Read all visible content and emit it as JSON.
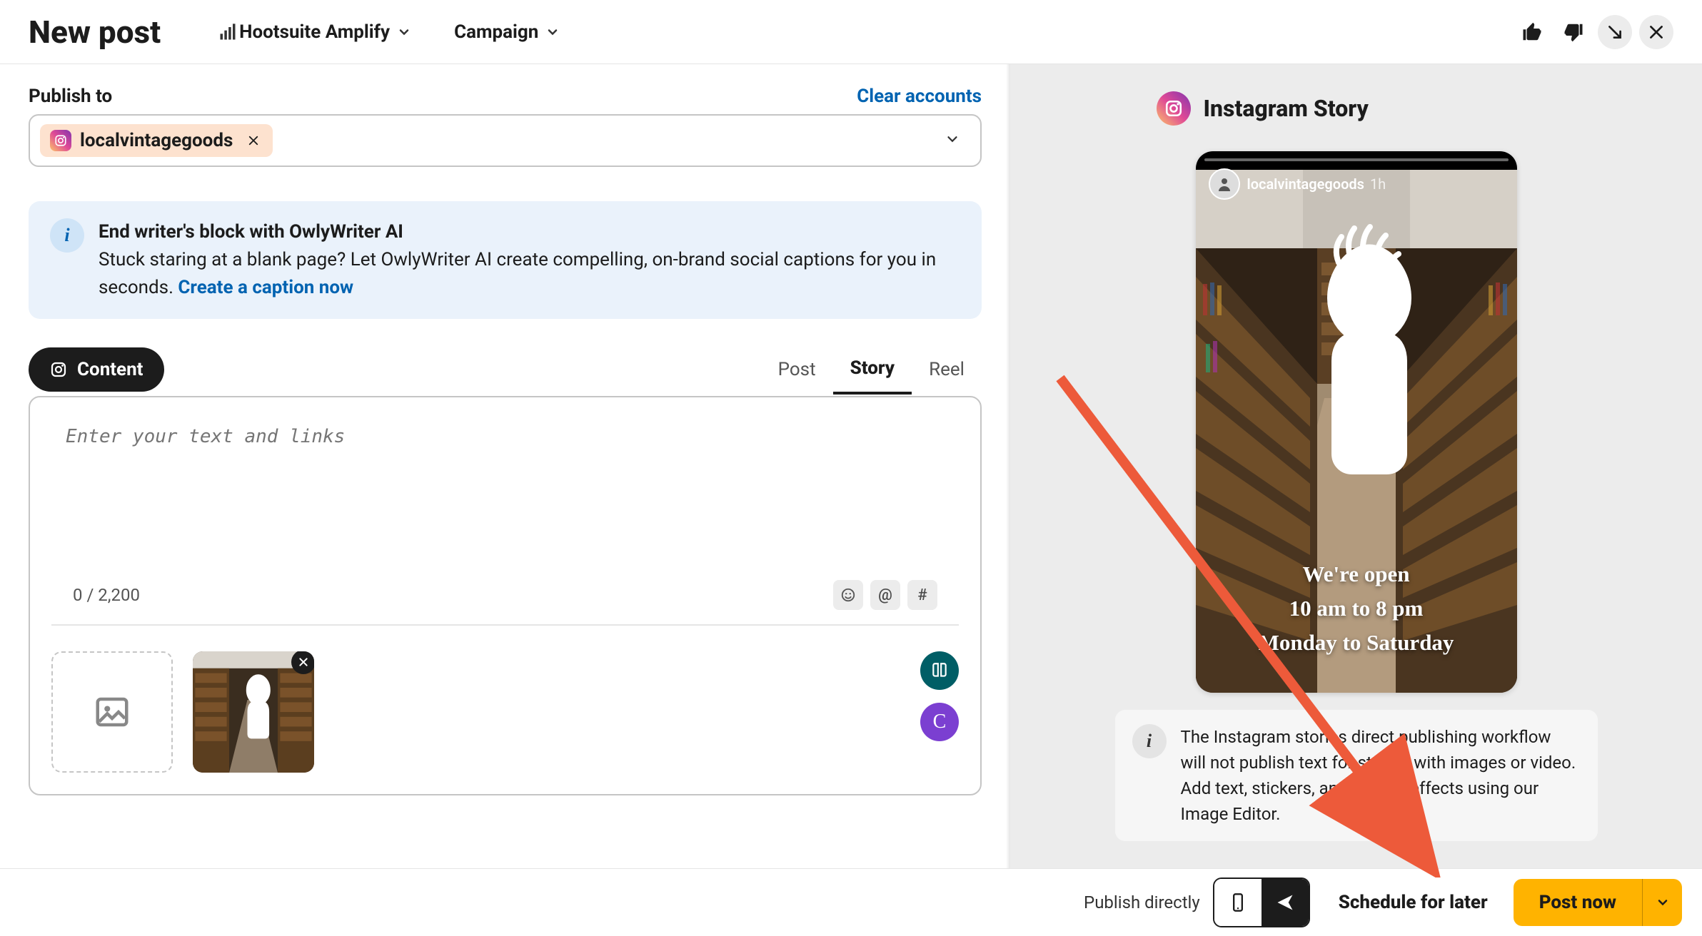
{
  "header": {
    "title": "New post",
    "amplify_label": "Hootsuite Amplify",
    "campaign_label": "Campaign"
  },
  "left": {
    "publish_label": "Publish to",
    "clear_accounts": "Clear accounts",
    "account_name": "localvintagegoods",
    "ai_title": "End writer's block with OwlyWriter AI",
    "ai_body": "Stuck staring at a blank page? Let OwlyWriter AI create compelling, on-brand social captions for you in seconds.",
    "ai_link": "Create a caption now",
    "content_tab": "Content",
    "post_types": {
      "post": "Post",
      "story": "Story",
      "reel": "Reel"
    },
    "textarea_placeholder": "Enter your text and links",
    "char_count": "0 / 2,200",
    "tool_at": "@",
    "tool_hash": "#",
    "canva_label": "C"
  },
  "preview": {
    "title": "Instagram Story",
    "username": "localvintagegoods",
    "time": "1h",
    "story_line1": "We're open",
    "story_line2": "10 am to 8 pm",
    "story_line3": "Monday to Saturday",
    "note": "The Instagram stories direct publishing workflow will not publish text for stories with images or video. Add text, stickers, and special effects using our Image Editor."
  },
  "footer": {
    "publish_direct_label": "Publish directly",
    "schedule_label": "Schedule for later",
    "post_now_label": "Post now"
  },
  "colors": {
    "accent_orange": "#ffb300",
    "link_blue": "#0063b1",
    "banner_bg": "#eaf2fb",
    "right_bg": "#ececec",
    "arrow_red": "#ed5a3a"
  }
}
